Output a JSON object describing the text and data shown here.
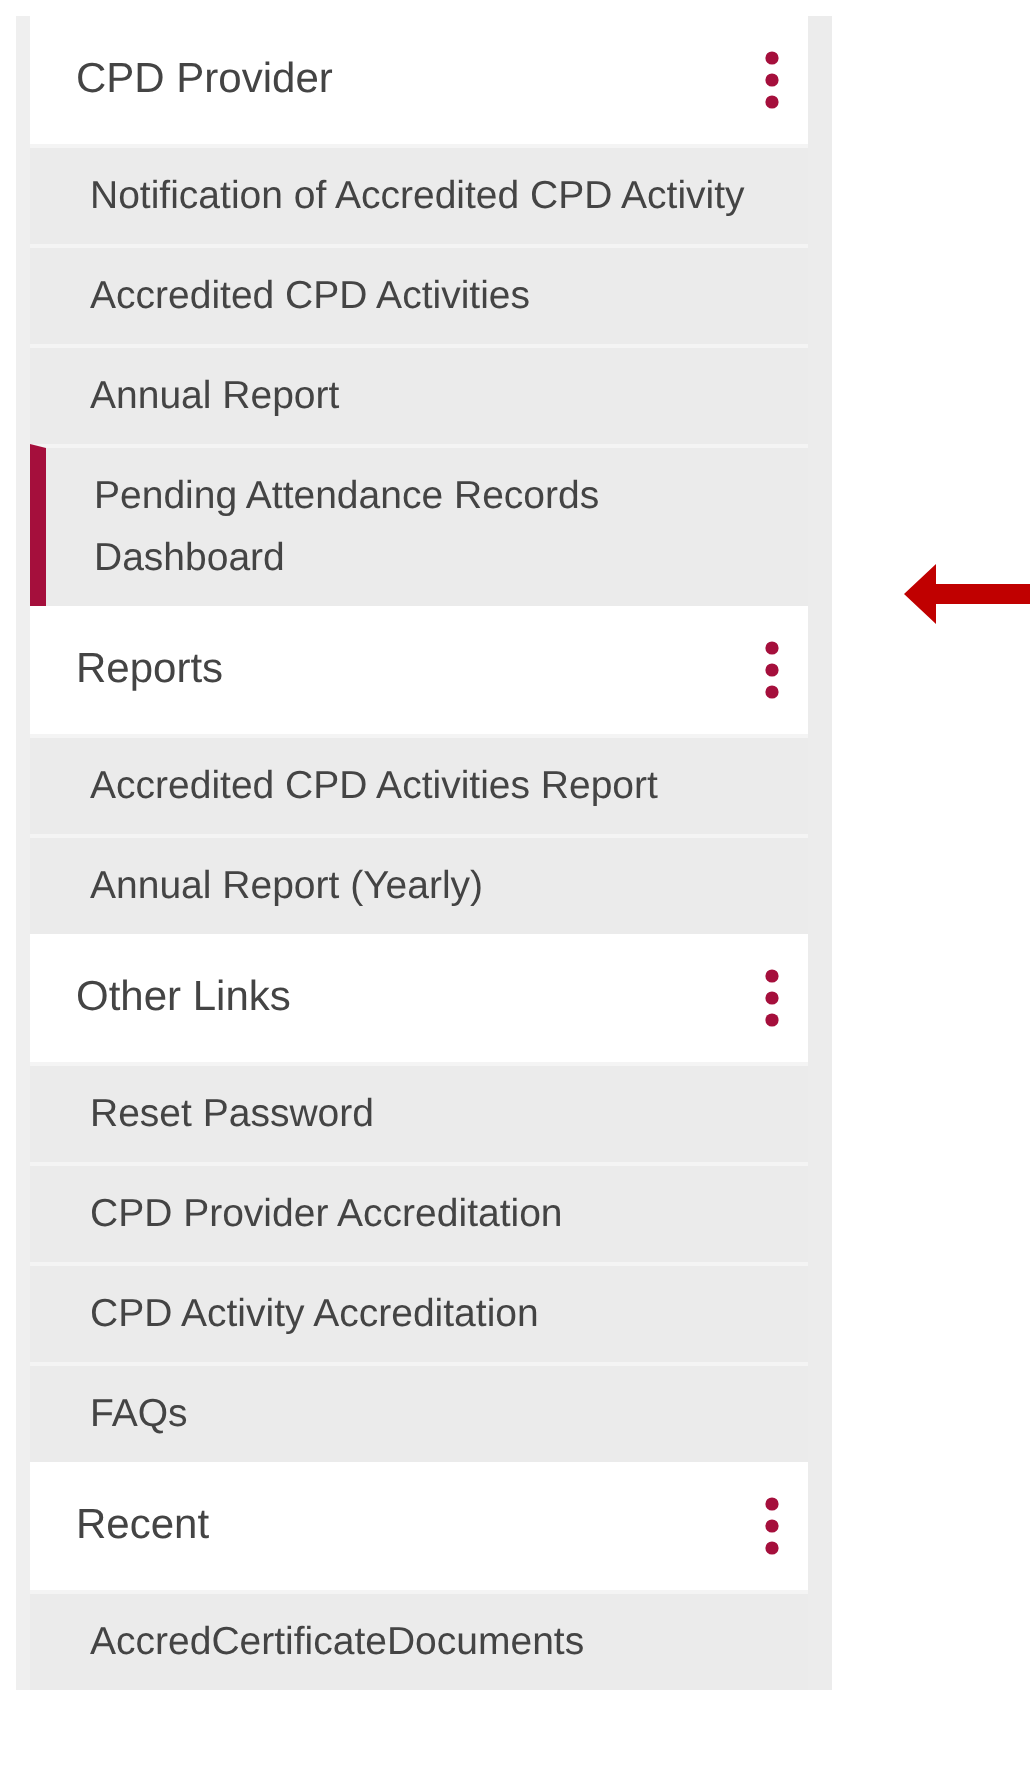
{
  "sections": [
    {
      "title": "CPD Provider",
      "items": [
        {
          "label": "Notification of Accredited CPD Activity",
          "selected": false
        },
        {
          "label": "Accredited CPD Activities",
          "selected": false
        },
        {
          "label": "Annual Report",
          "selected": false
        },
        {
          "label": "Pending Attendance Records Dashboard",
          "selected": true
        }
      ]
    },
    {
      "title": "Reports",
      "items": [
        {
          "label": "Accredited CPD Activities Report",
          "selected": false
        },
        {
          "label": "Annual Report (Yearly)",
          "selected": false
        }
      ]
    },
    {
      "title": "Other Links",
      "items": [
        {
          "label": "Reset Password",
          "selected": false
        },
        {
          "label": "CPD Provider Accreditation",
          "selected": false
        },
        {
          "label": "CPD Activity Accreditation",
          "selected": false
        },
        {
          "label": "FAQs",
          "selected": false
        }
      ]
    },
    {
      "title": "Recent",
      "items": [
        {
          "label": "AccredCertificateDocuments",
          "selected": false
        }
      ]
    }
  ]
}
